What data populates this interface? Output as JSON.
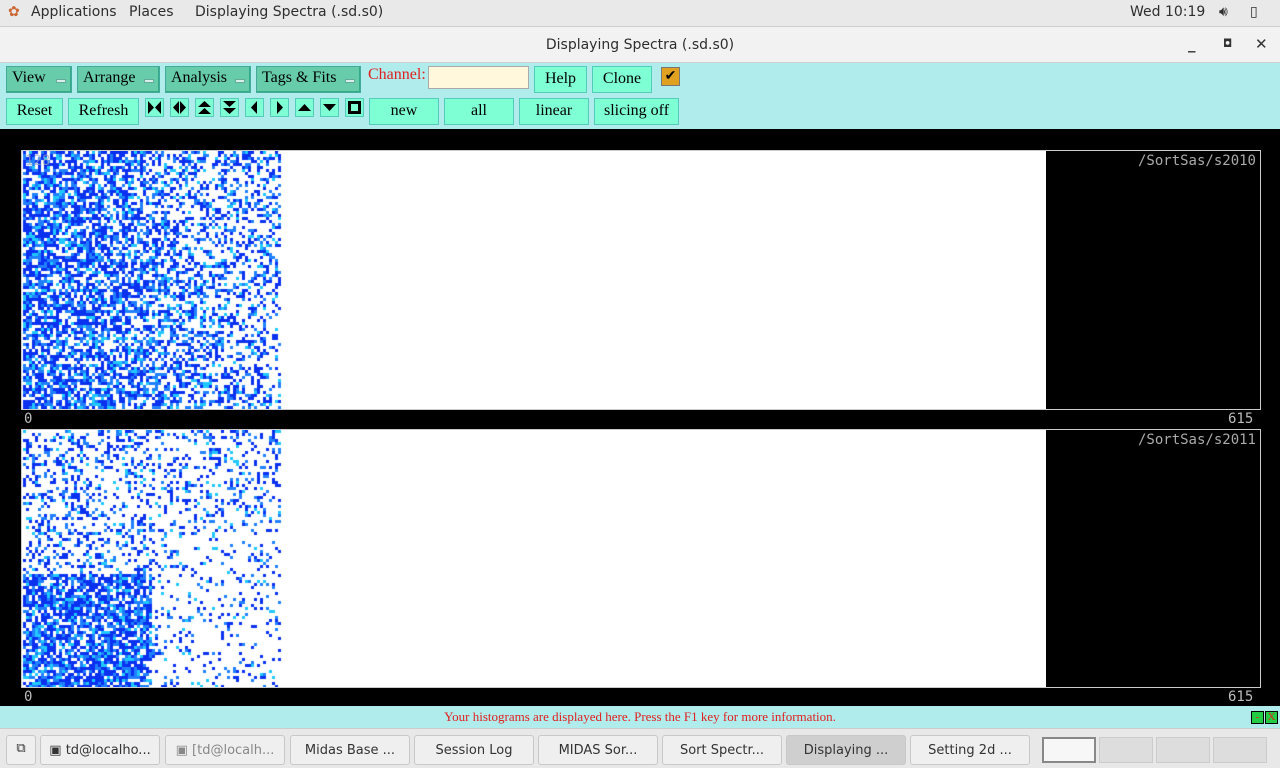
{
  "topbar": {
    "applications": "Applications",
    "places": "Places",
    "active_app": "Displaying Spectra (.sd.s0)",
    "clock": "Wed 10:19"
  },
  "window": {
    "title": "Displaying Spectra (.sd.s0)"
  },
  "toolbar": {
    "menus": [
      "View",
      "Arrange",
      "Analysis",
      "Tags & Fits"
    ],
    "channel_label": "Channel:",
    "channel_value": "",
    "help": "Help",
    "clone": "Clone",
    "check": "✔",
    "reset": "Reset",
    "refresh": "Refresh",
    "new": "new",
    "all": "all",
    "linear": "linear",
    "slicing": "slicing off"
  },
  "spectra": [
    {
      "name": "/SortSas/s2010",
      "y_max": "128",
      "x_min": "0",
      "x_max": "615"
    },
    {
      "name": "/SortSas/s2011",
      "x_min": "0",
      "x_max": "615"
    }
  ],
  "colors": {
    "accent": "#7fffd4",
    "menu": "#66ccaa",
    "bg": "#b0ecec",
    "status_text": "#e02020"
  },
  "status": {
    "message": "Your histograms are displayed here. Press the F1 key for more information."
  },
  "taskbar": {
    "items": [
      "td@localho...",
      "[td@localh...",
      "Midas Base ...",
      "Session Log",
      "MIDAS Sor...",
      "Sort Spectr...",
      "Displaying ...",
      "Setting 2d ..."
    ]
  }
}
